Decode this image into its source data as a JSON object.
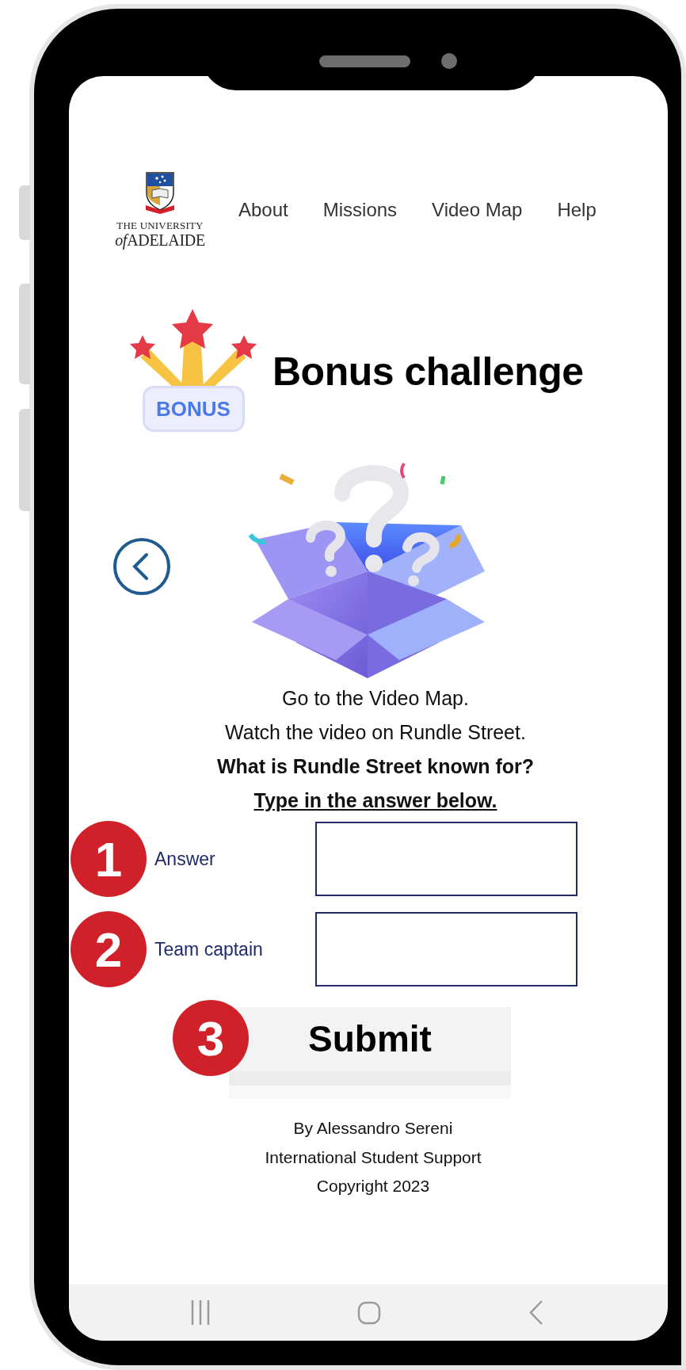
{
  "header": {
    "logo": {
      "line_1": "THE UNIVERSITY",
      "line_2_prefix": "of",
      "line_2": "ADELAIDE"
    },
    "nav": [
      "About",
      "Missions",
      "Video Map",
      "Help"
    ]
  },
  "title": {
    "badge": "BONUS",
    "text": "Bonus challenge"
  },
  "instructions": [
    {
      "text": "Go to the Video Map.",
      "kind": "plain"
    },
    {
      "text": "Watch the video on Rundle Street.",
      "kind": "plain"
    },
    {
      "text": "What is Rundle Street known for?",
      "kind": "bold"
    },
    {
      "text": "Type in the answer below.",
      "kind": "underlined"
    }
  ],
  "form": {
    "fields": [
      {
        "step": "1",
        "label": "Answer"
      },
      {
        "step": "2",
        "label": "Team captain"
      }
    ],
    "submit": {
      "step": "3",
      "label": "Submit"
    }
  },
  "footer": [
    "By Alessandro Sereni",
    "International Student Support",
    "Copyright 2023"
  ]
}
